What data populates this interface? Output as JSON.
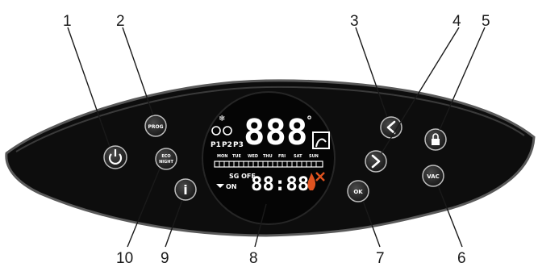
{
  "callouts": [
    "1",
    "2",
    "3",
    "4",
    "5",
    "6",
    "7",
    "8",
    "9",
    "10"
  ],
  "buttons": {
    "power_icon": "power-icon",
    "prog_label": "PROG",
    "eco_label_1": "ECO",
    "eco_label_2": "NIGHT",
    "info_label": "i",
    "left_icon": "chevron-left-icon",
    "right_icon": "chevron-right-icon",
    "lock_icon": "lock-icon",
    "vac_label": "VAC",
    "ok_label": "OK"
  },
  "display": {
    "main_digits": "888",
    "degree": "°",
    "program_labels": [
      "P1",
      "P2",
      "P3"
    ],
    "day_labels": [
      "MON",
      "TUE",
      "WED",
      "THU",
      "FRI",
      "SAT",
      "SUN"
    ],
    "sg_label": "SG OFF",
    "on_label": "ON",
    "time_digits": "88:88"
  },
  "colors": {
    "panel": "#0d0d0d",
    "panel_edge": "#5a5a5a",
    "button": "#2a2a2a",
    "button_ring": "#bdbdbd",
    "flame": "#e0531f",
    "text": "#1a1a1a"
  }
}
